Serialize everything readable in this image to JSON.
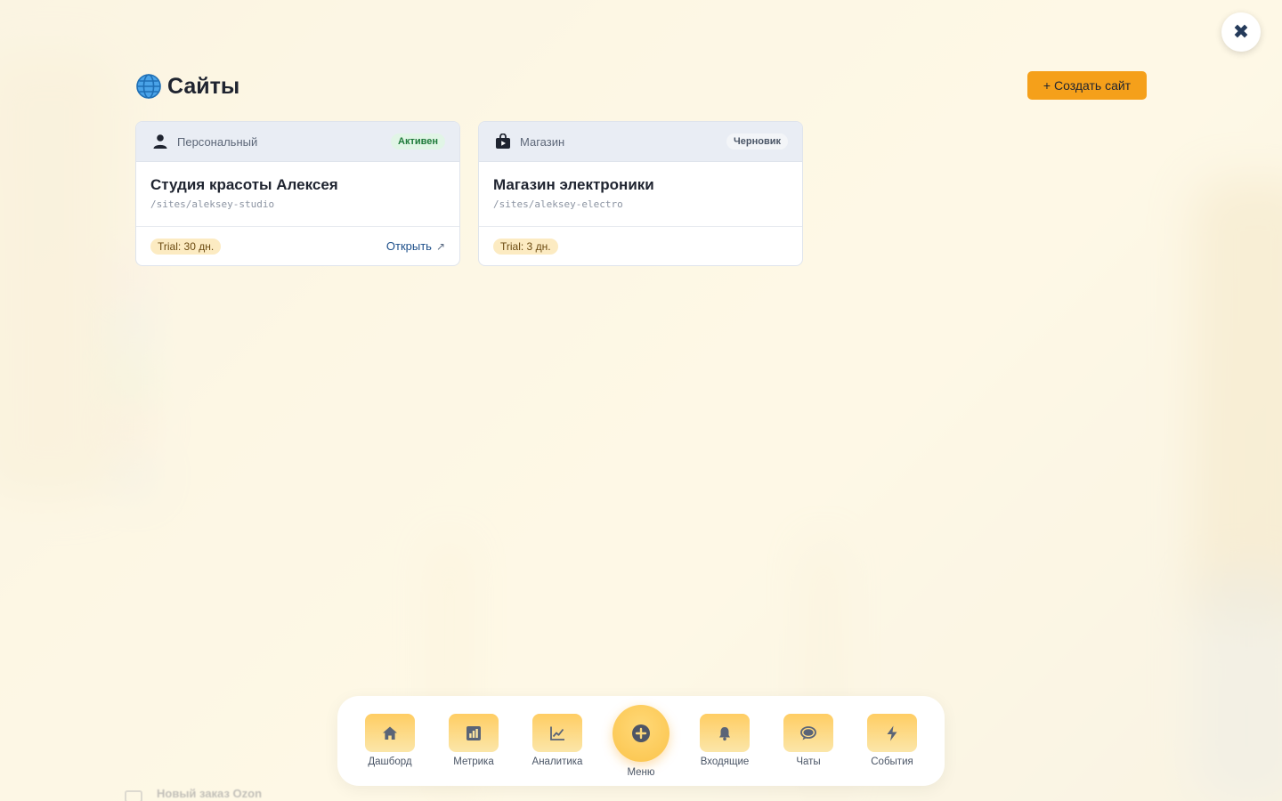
{
  "background": {
    "peek_text": "Новый заказ Ozon"
  },
  "header": {
    "title": "Сайты",
    "title_icon": "globe-icon",
    "create_button_label": "+ Создать сайт",
    "close_icon": "close-icon"
  },
  "sites": [
    {
      "type": "Персональный",
      "type_icon": "person-icon",
      "status": "Активен",
      "name": "Студия красоты Алексея",
      "path": "/sites/aleksey-studio",
      "trial": "Trial: 30 дн.",
      "open_label": "Открыть",
      "open_icon": "external-link-icon"
    },
    {
      "type": "Магазин",
      "type_icon": "shopping-bag-icon",
      "status": "Черновик",
      "name": "Магазин электроники",
      "path": "/sites/aleksey-electro",
      "trial": "Trial: 3 дн."
    }
  ],
  "bottom_nav": {
    "items": [
      {
        "label": "Дашборд",
        "icon": "home-icon"
      },
      {
        "label": "Метрика",
        "icon": "bar-chart-icon"
      },
      {
        "label": "Аналитика",
        "icon": "line-chart-icon"
      },
      {
        "label": "Входящие",
        "icon": "bell-icon"
      },
      {
        "label": "Чаты",
        "icon": "chat-bubble-icon"
      },
      {
        "label": "События",
        "icon": "bolt-icon"
      }
    ],
    "center": {
      "label": "Меню",
      "icon": "plus-circle-icon"
    }
  },
  "colors": {
    "accent": "#f5a01a",
    "active_badge": "#1e7a3a",
    "link": "#1d4f8a"
  }
}
